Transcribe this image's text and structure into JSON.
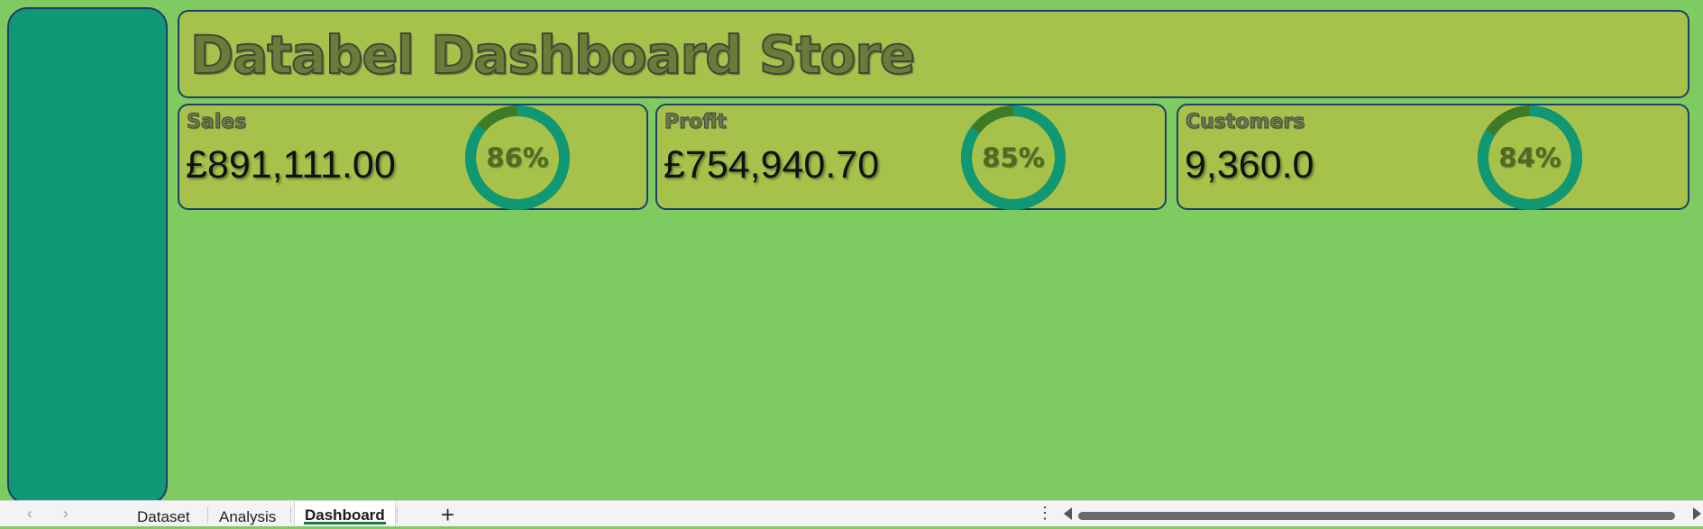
{
  "dashboard": {
    "title": "Databel Dashboard Store",
    "colors": {
      "background": "#7ecb62",
      "panel": "#a6c24b",
      "sidebar": "#0f9873",
      "ring": "#0f9873",
      "ring_rest": "#3f7a27"
    },
    "kpis": [
      {
        "label": "Sales",
        "value": "£891,111.00",
        "percent_text": "86%",
        "percent": 0.86
      },
      {
        "label": "Profit",
        "value": "£754,940.70",
        "percent_text": "85%",
        "percent": 0.85
      },
      {
        "label": "Customers",
        "value": "9,360.0",
        "percent_text": "84%",
        "percent": 0.84
      }
    ]
  },
  "sheet_tabs": {
    "tabs": [
      "Dataset",
      "Analysis",
      "Dashboard"
    ],
    "active": "Dashboard",
    "add_icon": "plus-icon",
    "nav_icons": [
      "prev-sheet-icon",
      "next-sheet-icon"
    ]
  }
}
